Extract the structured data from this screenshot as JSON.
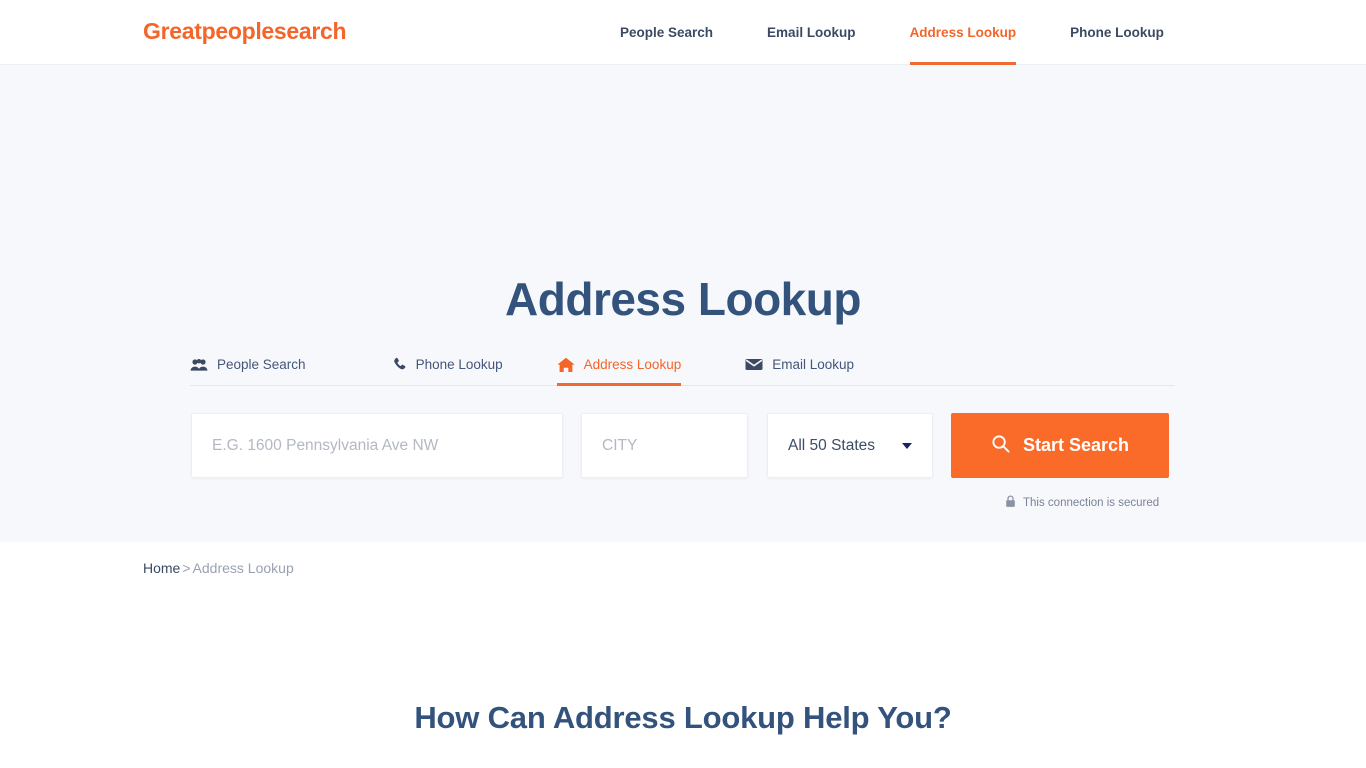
{
  "header": {
    "logo": "Greatpeoplesearch",
    "nav": [
      {
        "label": "People Search",
        "active": false
      },
      {
        "label": "Email Lookup",
        "active": false
      },
      {
        "label": "Address Lookup",
        "active": true
      },
      {
        "label": "Phone Lookup",
        "active": false
      }
    ]
  },
  "hero": {
    "title": "Address Lookup",
    "tabs": [
      {
        "label": "People Search",
        "icon": "users-icon",
        "active": false
      },
      {
        "label": "Phone Lookup",
        "icon": "phone-icon",
        "active": false
      },
      {
        "label": "Address Lookup",
        "icon": "home-icon",
        "active": true
      },
      {
        "label": "Email Lookup",
        "icon": "envelope-icon",
        "active": false
      }
    ],
    "form": {
      "address_placeholder": "E.G. 1600 Pennsylvania Ave NW",
      "address_value": "",
      "city_placeholder": "CITY",
      "city_value": "",
      "state_selected": "All 50 States",
      "search_button": "Start Search",
      "search_icon": "magnifier-icon",
      "secured_text": "This connection is secured",
      "secured_icon": "lock-icon"
    }
  },
  "breadcrumb": {
    "home": "Home",
    "separator": ">",
    "current": "Address Lookup"
  },
  "content": {
    "section_title": "How Can Address Lookup Help You?"
  },
  "colors": {
    "accent_orange": "#f4652a",
    "button_orange": "#fa6a28",
    "heading_navy": "#33537d",
    "hero_background": "#f7f8fc",
    "text_gray": "#7a8397"
  }
}
